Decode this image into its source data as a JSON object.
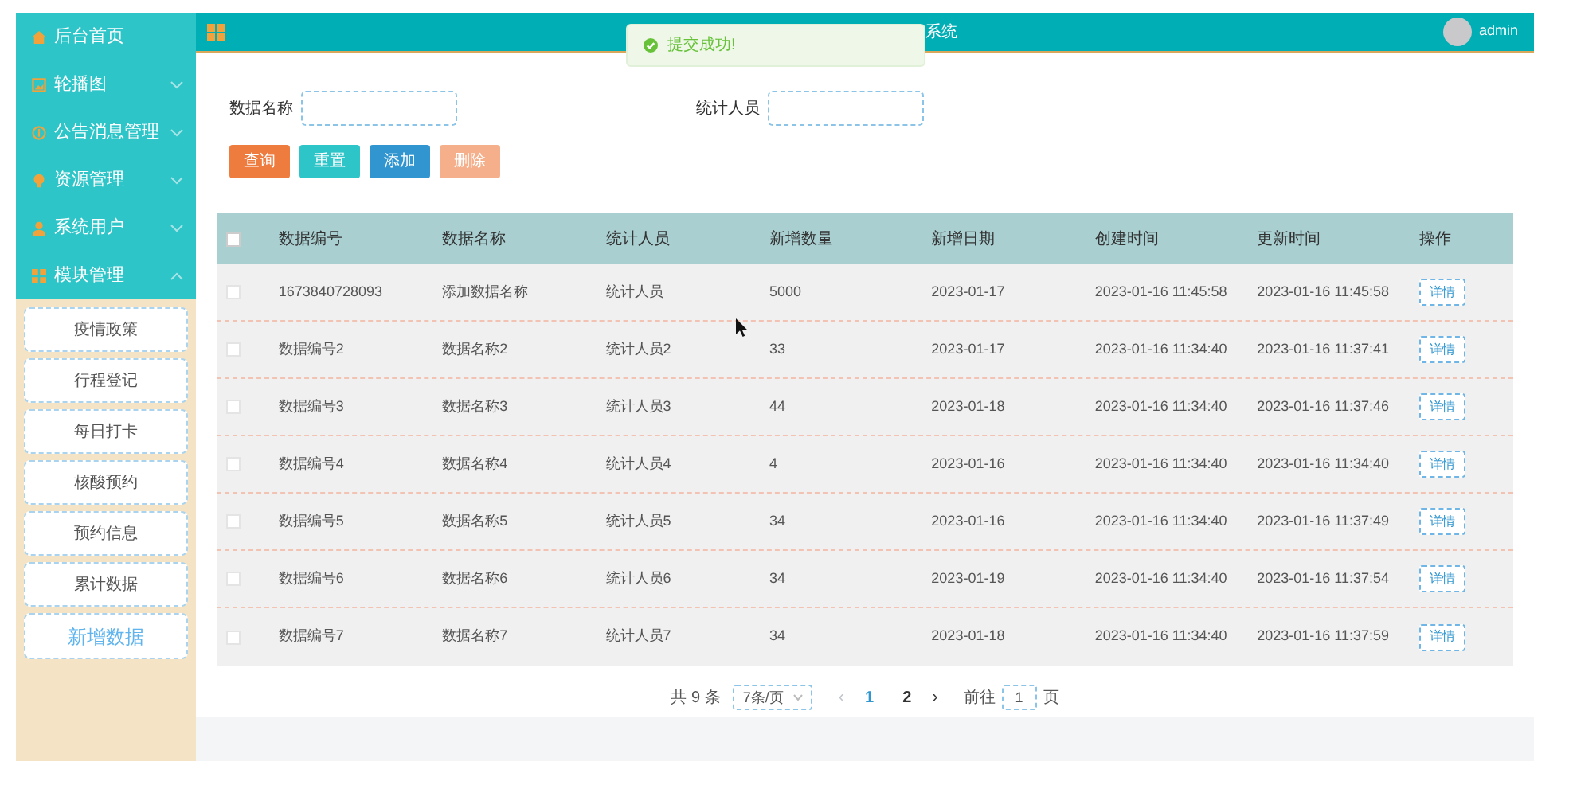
{
  "header": {
    "title": "系统",
    "user": "admin"
  },
  "toast": {
    "message": "提交成功!"
  },
  "sidebar": {
    "items": [
      {
        "label": "后台首页",
        "kind": "link"
      },
      {
        "label": "轮播图",
        "kind": "menu",
        "expanded": false
      },
      {
        "label": "公告消息管理",
        "kind": "menu",
        "expanded": false
      },
      {
        "label": "资源管理",
        "kind": "menu",
        "expanded": false
      },
      {
        "label": "系统用户",
        "kind": "menu",
        "expanded": false
      },
      {
        "label": "模块管理",
        "kind": "menu",
        "expanded": true,
        "children": [
          {
            "label": "疫情政策",
            "selected": false
          },
          {
            "label": "行程登记",
            "selected": false
          },
          {
            "label": "每日打卡",
            "selected": false
          },
          {
            "label": "核酸预约",
            "selected": false
          },
          {
            "label": "预约信息",
            "selected": false
          },
          {
            "label": "累计数据",
            "selected": false
          },
          {
            "label": "新增数据",
            "selected": true
          }
        ]
      }
    ]
  },
  "search": {
    "fields": [
      {
        "label": "数据名称"
      },
      {
        "label": "统计人员"
      }
    ],
    "buttons": [
      {
        "label": "查询",
        "kind": "search",
        "disabled": false
      },
      {
        "label": "重置",
        "kind": "reset",
        "disabled": false
      },
      {
        "label": "添加",
        "kind": "add",
        "disabled": false
      },
      {
        "label": "删除",
        "kind": "delete",
        "disabled": true
      }
    ]
  },
  "table": {
    "select_all": false,
    "columns": [
      "数据编号",
      "数据名称",
      "统计人员",
      "新增数量",
      "新增日期",
      "创建时间",
      "更新时间",
      "操作"
    ],
    "rows": [
      {
        "checked": false,
        "cells": [
          "1673840728093",
          "添加数据名称",
          "统计人员",
          "5000",
          "2023-01-17",
          "2023-01-16 11:45:58",
          "2023-01-16 11:45:58"
        ],
        "action": "详情"
      },
      {
        "checked": false,
        "cells": [
          "数据编号2",
          "数据名称2",
          "统计人员2",
          "33",
          "2023-01-17",
          "2023-01-16 11:34:40",
          "2023-01-16 11:37:41"
        ],
        "action": "详情"
      },
      {
        "checked": false,
        "cells": [
          "数据编号3",
          "数据名称3",
          "统计人员3",
          "44",
          "2023-01-18",
          "2023-01-16 11:34:40",
          "2023-01-16 11:37:46"
        ],
        "action": "详情"
      },
      {
        "checked": false,
        "cells": [
          "数据编号4",
          "数据名称4",
          "统计人员4",
          "4",
          "2023-01-16",
          "2023-01-16 11:34:40",
          "2023-01-16 11:34:40"
        ],
        "action": "详情"
      },
      {
        "checked": false,
        "cells": [
          "数据编号5",
          "数据名称5",
          "统计人员5",
          "34",
          "2023-01-16",
          "2023-01-16 11:34:40",
          "2023-01-16 11:37:49"
        ],
        "action": "详情"
      },
      {
        "checked": false,
        "cells": [
          "数据编号6",
          "数据名称6",
          "统计人员6",
          "34",
          "2023-01-19",
          "2023-01-16 11:34:40",
          "2023-01-16 11:37:54"
        ],
        "action": "详情"
      },
      {
        "checked": false,
        "cells": [
          "数据编号7",
          "数据名称7",
          "统计人员7",
          "34",
          "2023-01-18",
          "2023-01-16 11:34:40",
          "2023-01-16 11:37:59"
        ],
        "action": "详情"
      }
    ]
  },
  "pagination": {
    "total": "共 9 条",
    "page_size": "7条/页",
    "prev": "‹",
    "pages": [
      {
        "label": "1",
        "selected": true
      },
      {
        "label": "2",
        "selected": false
      }
    ],
    "next": "›",
    "goto_label": "前往",
    "goto_value": "1",
    "goto_suffix": "页"
  }
}
